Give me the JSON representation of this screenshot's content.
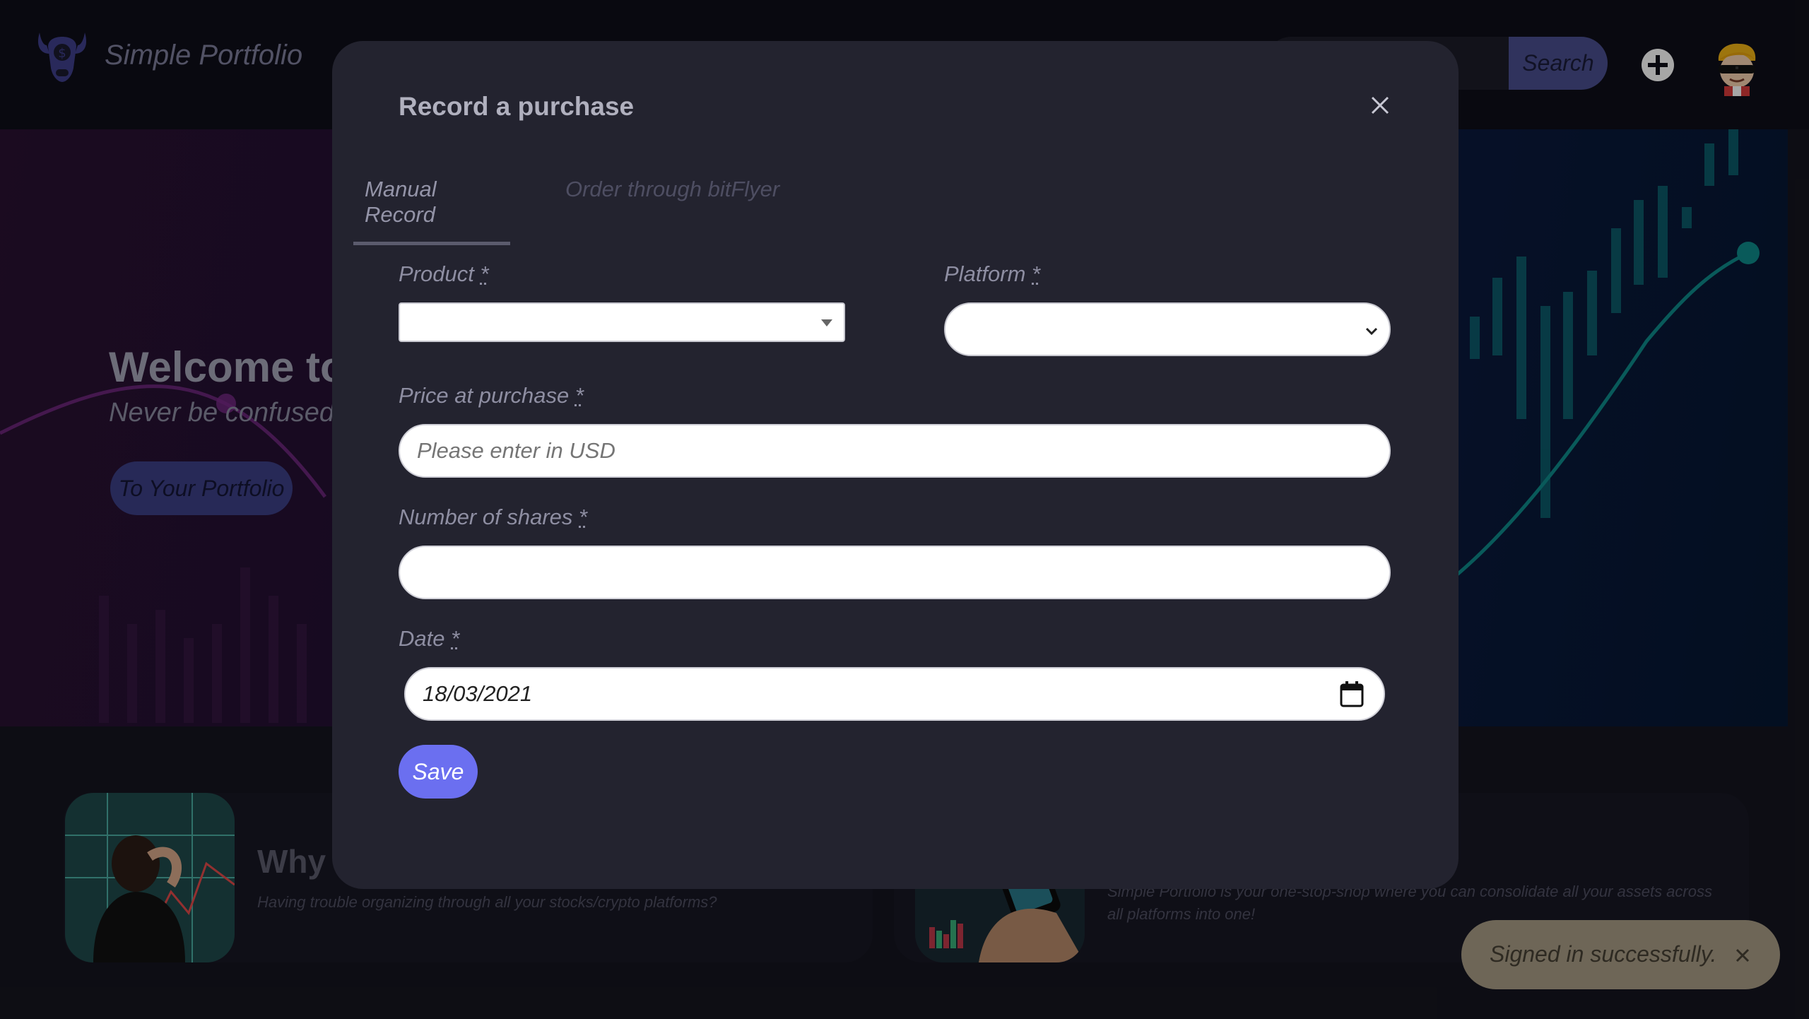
{
  "header": {
    "brand_name": "Simple Portfolio",
    "search_placeholder": "",
    "search_button": "Search"
  },
  "hero": {
    "title": "Welcome to y",
    "subtitle": "Never be confused, J",
    "cta_label": "To Your Portfolio"
  },
  "cards": [
    {
      "title": "Why s",
      "text": "Having trouble organizing through all your stocks/crypto platforms?"
    },
    {
      "title": "",
      "text": "Simple Portfolio is your one-stop-shop where you can consolidate all your assets across all platforms into one!"
    }
  ],
  "modal": {
    "title": "Record a purchase",
    "tabs": [
      {
        "label": "Manual Record",
        "active": true
      },
      {
        "label": "Order through bitFlyer",
        "active": false
      }
    ],
    "fields": {
      "product_label": "Product",
      "platform_label": "Platform",
      "price_label": "Price at purchase",
      "price_placeholder": "Please enter in USD",
      "shares_label": "Number of shares",
      "date_label": "Date",
      "date_value": "18/03/2021",
      "required_mark": "*"
    },
    "save_label": "Save"
  },
  "toast": {
    "message": "Signed in successfully."
  },
  "colors": {
    "accent": "#6b6ff0",
    "search_button": "#4a4f8f",
    "modal_bg": "#23232f",
    "toast_bg": "#6e6657"
  },
  "icons": [
    "bull-logo-icon",
    "plus-circle-icon",
    "avatar-icon",
    "close-icon",
    "caret-down-icon",
    "chevron-down-icon",
    "calendar-icon"
  ]
}
